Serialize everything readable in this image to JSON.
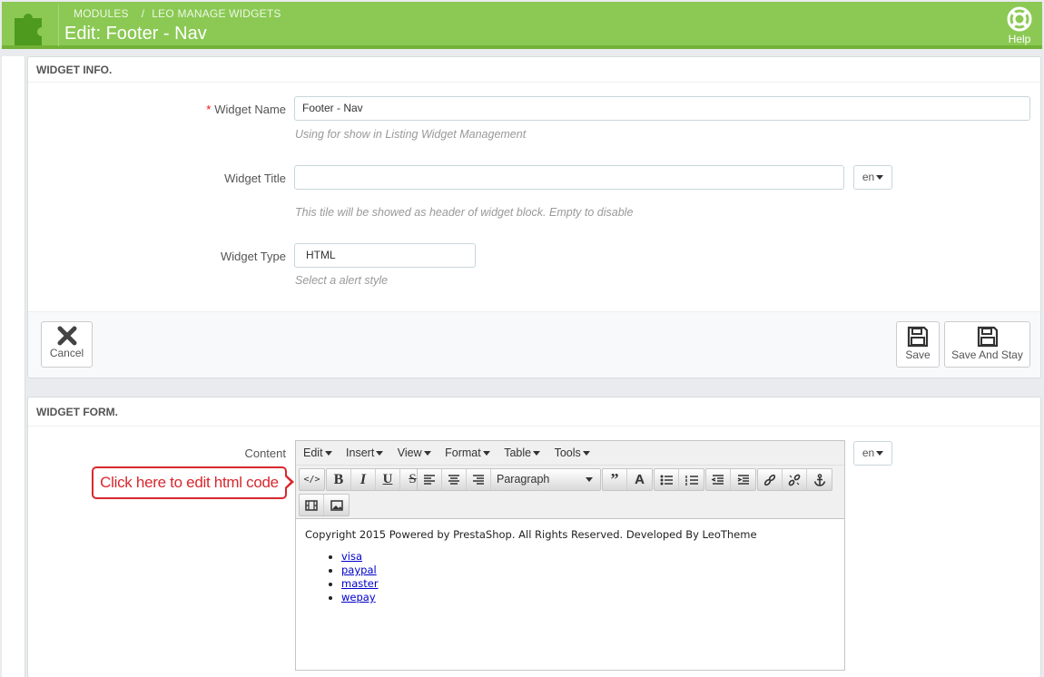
{
  "header": {
    "breadcrumb": [
      "MODULES",
      "LEO MANAGE WIDGETS"
    ],
    "separator": "/",
    "title": "Edit: Footer - Nav",
    "help_label": "Help",
    "accent": "#8bc954"
  },
  "widget_info": {
    "heading": "WIDGET INFO.",
    "name_required_mark": "*",
    "name_label": "Widget Name",
    "name_value": "Footer - Nav",
    "name_help": "Using for show in Listing Widget Management",
    "title_label": "Widget Title",
    "title_value": "",
    "title_lang": "en",
    "title_help": "This tile will be showed as header of widget block. Empty to disable",
    "type_label": "Widget Type",
    "type_value": "HTML",
    "type_help": "Select a alert style",
    "cancel_label": "Cancel",
    "save_label": "Save",
    "save_stay_label": "Save And Stay"
  },
  "widget_form": {
    "heading": "WIDGET FORM.",
    "content_label": "Content",
    "content_lang": "en",
    "menu": [
      "Edit",
      "Insert",
      "View",
      "Format",
      "Table",
      "Tools"
    ],
    "format_select": "Paragraph",
    "content_text": "Copyright 2015 Powered by PrestaShop. All Rights Reserved. Developed By LeoTheme",
    "links": [
      "visa",
      "paypal",
      "master",
      "wepay"
    ]
  },
  "callout": {
    "text": "Click here to edit html code",
    "color": "#d8282e"
  }
}
